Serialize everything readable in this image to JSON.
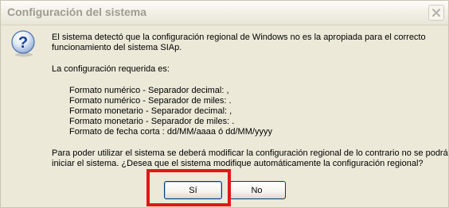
{
  "dialog": {
    "title": "Configuración del sistema",
    "close_icon": "close-icon",
    "message_icon": "question-icon"
  },
  "message": {
    "intro_line1": "El sistema detectó que la configuración regional de Windows no es la apropiada para el correcto",
    "intro_line2": "funcionamiento del sistema SIAp.",
    "required_heading": "La configuración requerida es:",
    "settings": [
      "Formato numérico - Separador decimal: ,",
      "Formato numérico - Separador de miles: .",
      "Formato monetario - Separador decimal: ,",
      "Formato monetario - Separador de miles: .",
      "Formato de fecha corta : dd/MM/aaaa ó dd/MM/yyyy"
    ],
    "question_line1": "Para poder utilizar el sistema se deberá modificar la configuración regional de lo contrario no se podrá",
    "question_line2": "iniciar el sistema. ¿Desea que el sistema modifique automáticamente la configuración regional?"
  },
  "buttons": {
    "yes_label": "Sí",
    "no_label": "No"
  },
  "colors": {
    "highlight": "#e01818",
    "dialog_background": "#ece9d8"
  }
}
